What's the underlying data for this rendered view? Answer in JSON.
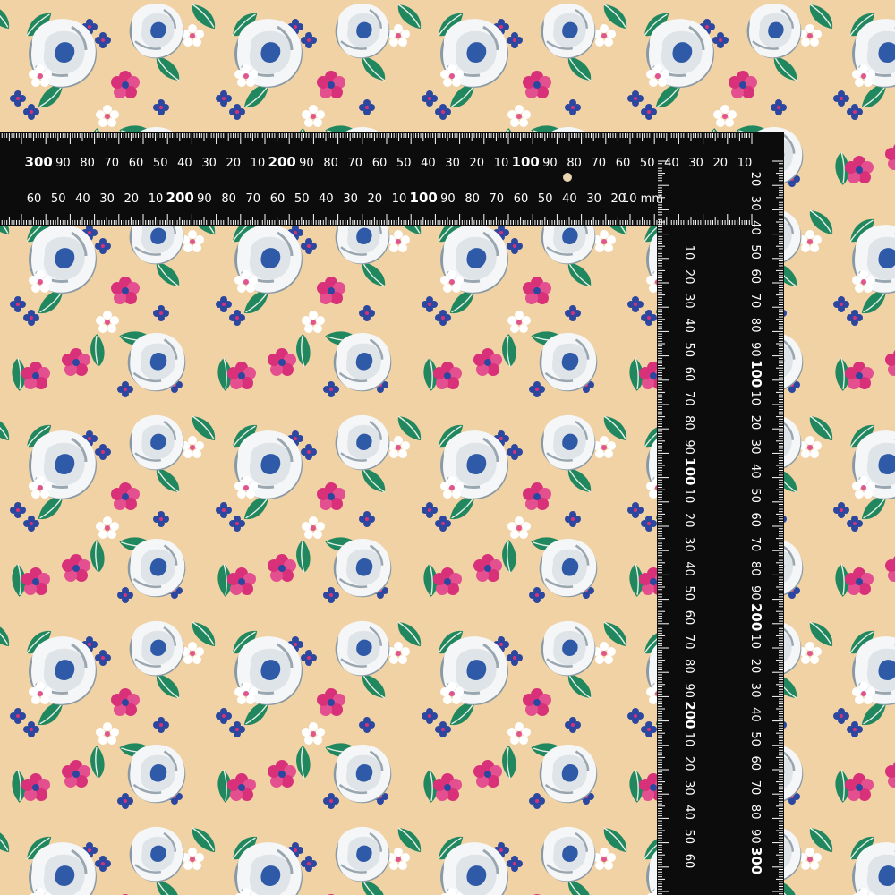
{
  "image": {
    "subject": "floral-cotton-fabric-with-measuring-ruler",
    "colors": {
      "background": "#f1d2a4",
      "rose_white": "#f4f6f7",
      "rose_grey": "#8a9aa5",
      "rose_blue": "#2f5aa8",
      "leaf_green": "#21875f",
      "leaf_dark": "#1b6a4c",
      "pink": "#d8317a",
      "blue_flower": "#2c47a0",
      "ruler": "#0c0c0c",
      "ruler_marks": "#ffffff"
    }
  },
  "ruler": {
    "unit": "mm",
    "top_row_1": [
      "300",
      "90",
      "80",
      "70",
      "60",
      "50",
      "40",
      "30",
      "20",
      "10",
      "200",
      "90",
      "80",
      "70",
      "60",
      "50",
      "40",
      "30",
      "20",
      "10",
      "100",
      "90",
      "80",
      "70",
      "60",
      "50",
      "40",
      "30",
      "20",
      "10"
    ],
    "top_row_2": [
      "60",
      "50",
      "40",
      "30",
      "20",
      "10",
      "200",
      "90",
      "80",
      "70",
      "60",
      "50",
      "40",
      "30",
      "20",
      "10",
      "100",
      "90",
      "80",
      "70",
      "60",
      "50",
      "40",
      "30",
      "20",
      "10 mm"
    ],
    "right_col_1": [
      "20",
      "30",
      "40",
      "50",
      "60",
      "70",
      "80",
      "90",
      "100",
      "10",
      "20",
      "30",
      "40",
      "50",
      "60",
      "70",
      "80",
      "90",
      "200",
      "10",
      "20",
      "30",
      "40",
      "50",
      "60",
      "70",
      "80",
      "90",
      "300"
    ],
    "right_col_2": [
      "10",
      "20",
      "30",
      "40",
      "50",
      "60",
      "70",
      "80",
      "90",
      "100",
      "10",
      "20",
      "30",
      "40",
      "50",
      "60",
      "70",
      "80",
      "90",
      "200",
      "10",
      "20",
      "30",
      "40",
      "50",
      "60"
    ]
  }
}
